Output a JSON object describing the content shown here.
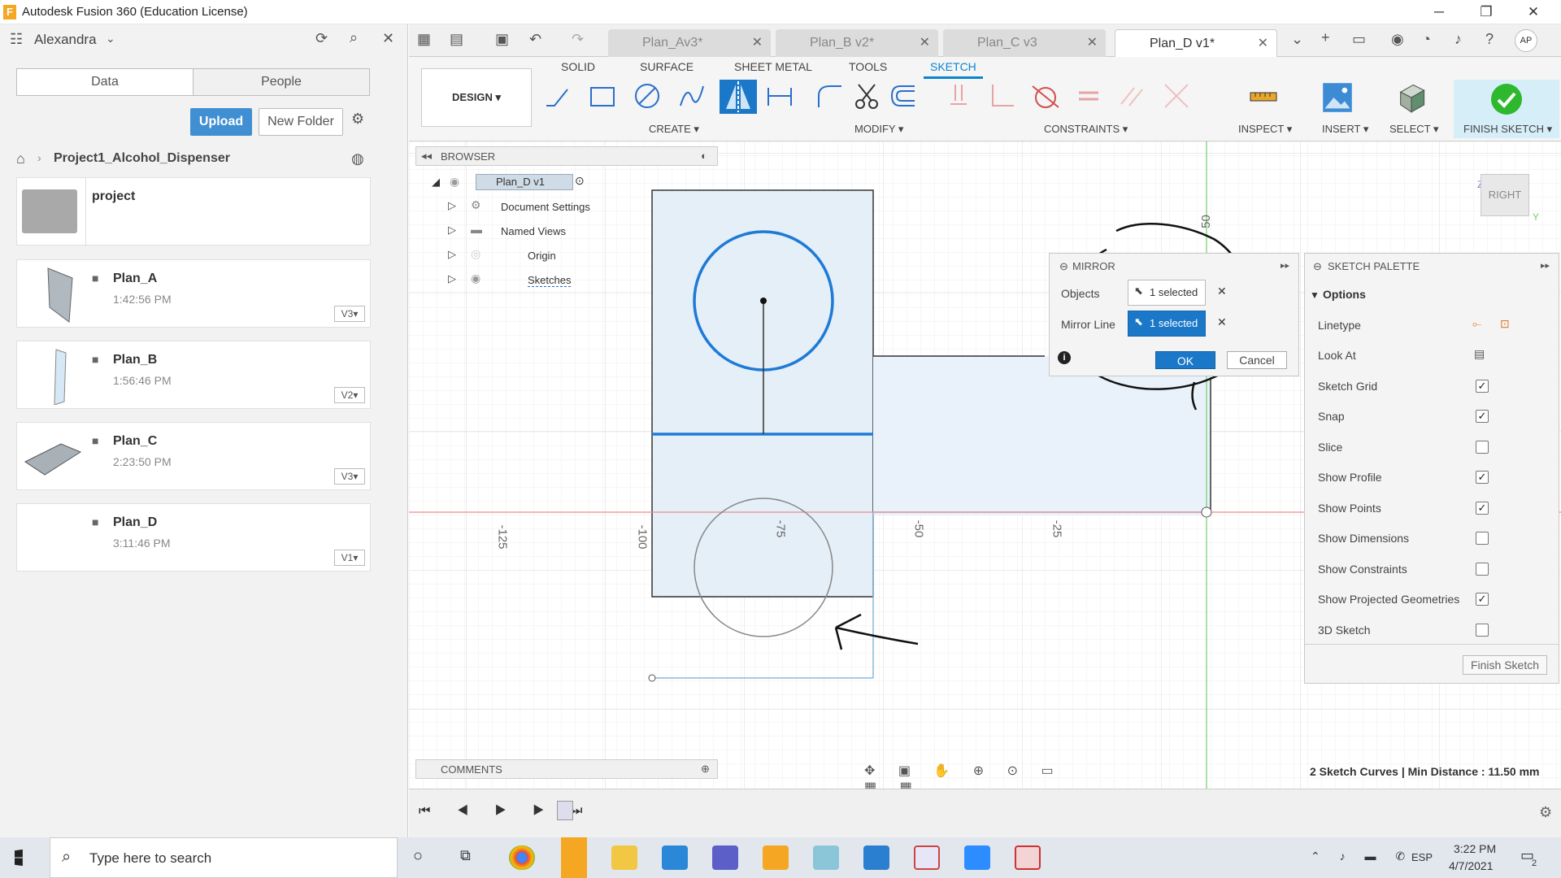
{
  "titlebar": {
    "title": "Autodesk Fusion 360 (Education License)",
    "minimize": "─",
    "maximize": "❐",
    "close": "✕"
  },
  "datapanel": {
    "user": "Alexandra",
    "tabs": {
      "data": "Data",
      "people": "People"
    },
    "upload": "Upload",
    "new_folder": "New Folder",
    "breadcrumb": "Project1_Alcohol_Dispenser",
    "folder": {
      "name": "project"
    },
    "files": [
      {
        "name": "Plan_A",
        "time": "1:42:56 PM",
        "version": "V3▾"
      },
      {
        "name": "Plan_B",
        "time": "1:56:46 PM",
        "version": "V2▾"
      },
      {
        "name": "Plan_C",
        "time": "2:23:50 PM",
        "version": "V3▾"
      },
      {
        "name": "Plan_D",
        "time": "3:11:46 PM",
        "version": "V1▾"
      }
    ]
  },
  "doctabs": [
    {
      "label": "Plan_Av3*"
    },
    {
      "label": "Plan_B v2*"
    },
    {
      "label": "Plan_C v3"
    },
    {
      "label": "Plan_D v1*"
    }
  ],
  "ribbon": {
    "design": "DESIGN ▾",
    "tabs": [
      "SOLID",
      "SURFACE",
      "SHEET METAL",
      "TOOLS",
      "SKETCH"
    ],
    "groups": {
      "create": "CREATE ▾",
      "modify": "MODIFY ▾",
      "constraints": "CONSTRAINTS ▾",
      "inspect": "INSPECT ▾",
      "insert": "INSERT ▾",
      "select": "SELECT ▾",
      "finish": "FINISH SKETCH ▾"
    }
  },
  "browser": {
    "title": "BROWSER",
    "root": "Plan_D v1",
    "items": [
      "Document Settings",
      "Named Views",
      "Origin",
      "Sketches"
    ]
  },
  "axis_labels": {
    "y50": "50",
    "xm125": "-125",
    "xm100": "-100",
    "xm75": "-75",
    "xm50": "-50",
    "xm25": "-25"
  },
  "viewcube": {
    "face": "RIGHT",
    "z": "Z",
    "y": "Y"
  },
  "mirror": {
    "title": "MIRROR",
    "objects_label": "Objects",
    "objects_value": "1 selected",
    "line_label": "Mirror Line",
    "line_value": "1 selected",
    "ok": "OK",
    "cancel": "Cancel"
  },
  "palette": {
    "title": "SKETCH PALETTE",
    "section": "Options",
    "rows": [
      {
        "label": "Linetype"
      },
      {
        "label": "Look At"
      },
      {
        "label": "Sketch Grid",
        "checked": "✓"
      },
      {
        "label": "Snap",
        "checked": "✓"
      },
      {
        "label": "Slice",
        "checked": ""
      },
      {
        "label": "Show Profile",
        "checked": "✓"
      },
      {
        "label": "Show Points",
        "checked": "✓"
      },
      {
        "label": "Show Dimensions",
        "checked": ""
      },
      {
        "label": "Show Constraints",
        "checked": ""
      },
      {
        "label": "Show Projected Geometries",
        "checked": "✓"
      },
      {
        "label": "3D Sketch",
        "checked": ""
      }
    ],
    "finish": "Finish Sketch"
  },
  "comments": "COMMENTS",
  "status": "2 Sketch Curves | Min Distance : 11.50 mm",
  "taskbar": {
    "search": "Type here to search",
    "time": "3:22 PM",
    "date": "4/7/2021",
    "lang": "ESP",
    "notif": "2"
  }
}
